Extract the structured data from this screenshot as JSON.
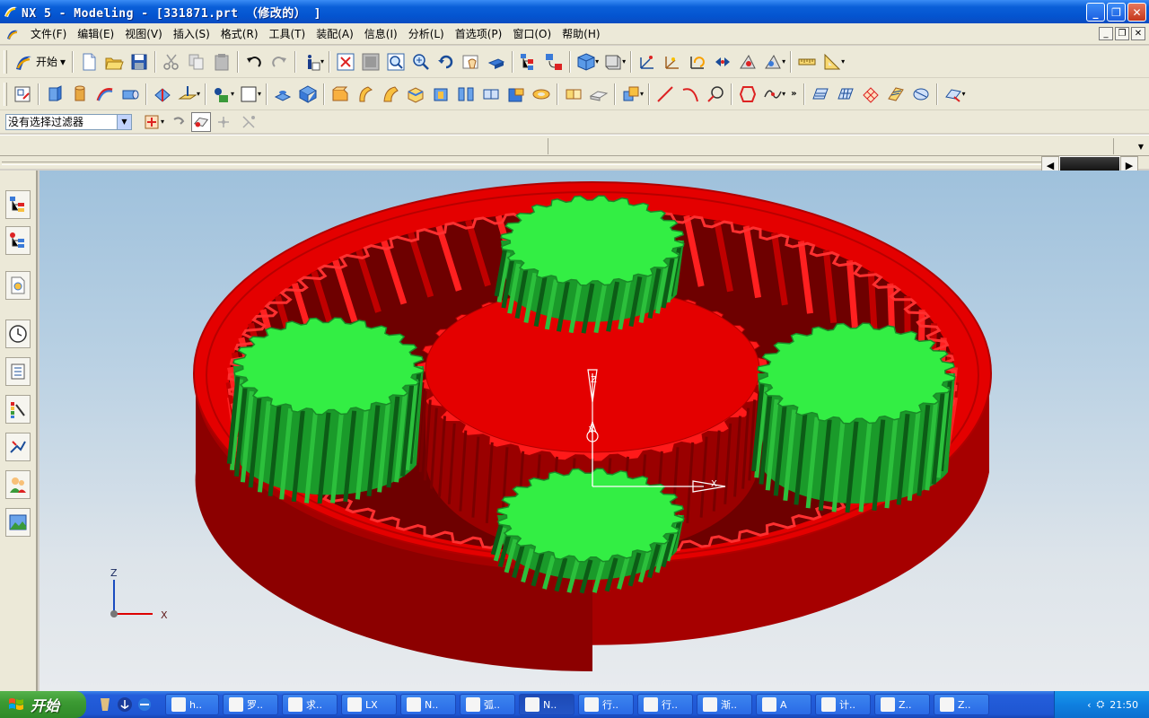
{
  "window": {
    "title": "NX 5 - Modeling - [331871.prt （修改的） ]",
    "controls": [
      "minimize",
      "restore",
      "close"
    ]
  },
  "menubar": {
    "items": [
      "文件(F)",
      "编辑(E)",
      "视图(V)",
      "插入(S)",
      "格式(R)",
      "工具(T)",
      "装配(A)",
      "信息(I)",
      "分析(L)",
      "首选项(P)",
      "窗口(O)",
      "帮助(H)"
    ]
  },
  "toolbar": {
    "start_label": "开始",
    "selection_filter": "没有选择过滤器"
  },
  "viewport": {
    "wcs_axes": {
      "x": "X",
      "y": "Y",
      "z": "Z"
    },
    "triad": {
      "x": "X",
      "z": "Z"
    },
    "colors": {
      "ring_gear": "#e40000",
      "planet_gears": "#33ee44",
      "sun_gear": "#e40000",
      "background_top": "#9fc1dc",
      "background_bottom": "#e8ebee"
    }
  },
  "taskbar": {
    "start_label": "开始",
    "tasks": [
      {
        "label": "h..",
        "icon": "ie-icon"
      },
      {
        "label": "罗..",
        "icon": "folder-icon"
      },
      {
        "label": "求..",
        "icon": "ie-icon"
      },
      {
        "label": "LX",
        "icon": "folder-icon"
      },
      {
        "label": "N..",
        "icon": "app-icon"
      },
      {
        "label": "弧..",
        "icon": "ie-icon"
      },
      {
        "label": "N..",
        "icon": "nx-icon"
      },
      {
        "label": "行..",
        "icon": "app-icon"
      },
      {
        "label": "行..",
        "icon": "doc-icon"
      },
      {
        "label": "渐..",
        "icon": "doc-icon"
      },
      {
        "label": "A",
        "icon": "folder-icon"
      },
      {
        "label": "计..",
        "icon": "doc-icon"
      },
      {
        "label": "Z..",
        "icon": "doc-icon"
      },
      {
        "label": "Z..",
        "icon": "doc-icon"
      }
    ],
    "clock": "21:50"
  }
}
